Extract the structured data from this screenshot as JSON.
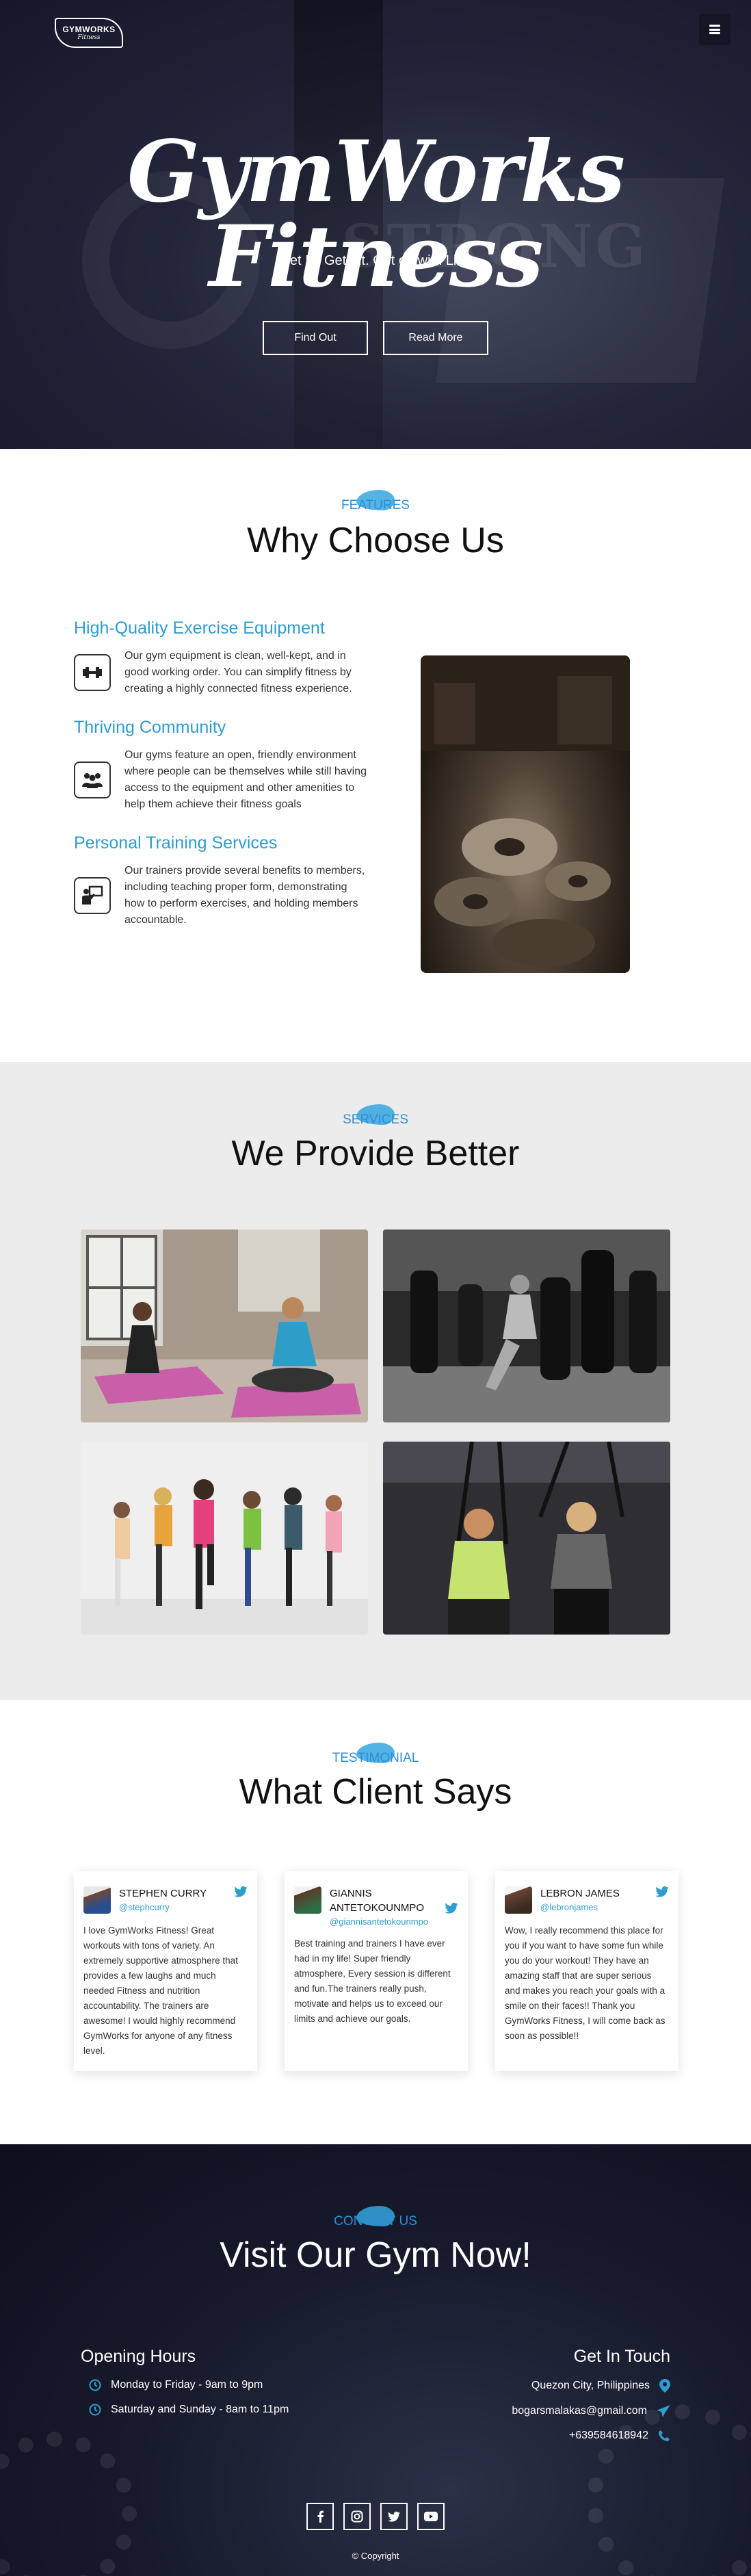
{
  "header": {
    "logo_line1": "GYMWORKS",
    "logo_line2": "Fitness",
    "menu_icon": "hamburger-menu-icon"
  },
  "hero": {
    "title": "GymWorks Fitness",
    "subtitle": "Get In. Get Fit. Get on with Life.",
    "buttons": [
      {
        "label": "Find Out"
      },
      {
        "label": "Read More"
      }
    ]
  },
  "features": {
    "tag": "FEATURES",
    "title": "Why Choose Us",
    "items": [
      {
        "title": "High-Quality Exercise Equipment",
        "icon": "dumbbell-icon",
        "text": "Our gym equipment is clean, well-kept, and in good working order. You can simplify fitness by creating a highly connected fitness experience."
      },
      {
        "title": "Thriving Community",
        "icon": "people-group-icon",
        "text": "Our gyms feature an open, friendly environment where people can be themselves while still having access to the equipment and other amenities to help them achieve their fitness goals"
      },
      {
        "title": "Personal Training Services",
        "icon": "trainer-board-icon",
        "text": "Our trainers provide several benefits to members, including teaching proper form, demonstrating how to perform exercises, and holding members accountable."
      }
    ]
  },
  "services": {
    "tag": "SERVICES",
    "title": "We Provide Better"
  },
  "testimonials": {
    "tag": "TESTIMONIAL",
    "title": "What Client Says",
    "cards": [
      {
        "name": "STEPHEN CURRY",
        "handle": "@stephcurry",
        "text": "I love GymWorks Fitness! Great workouts with tons of variety. An extremely supportive atmosphere that provides a few laughs and much needed Fitness and nutrition accountability. The trainers are awesome! I would highly recommend GymWorks for anyone of any fitness level."
      },
      {
        "name": "GIANNIS ANTETOKOUNMPO",
        "handle": "@giannisantetokounmpo",
        "text": "Best training and trainers I have ever had in my life! Super friendly atmosphere, Every session is different and fun.The trainers really push, motivate and helps us to exceed our limits and achieve our goals."
      },
      {
        "name": "LEBRON JAMES",
        "handle": "@lebronjames",
        "text": "Wow, I really recommend this place for you if you want to have some fun while you do your workout! They have an amazing staff that are super serious and makes you reach your goals with a smile on their faces!! Thank you GymWorks Fitness, I will come back as soon as possible!!"
      }
    ]
  },
  "contact": {
    "tag": "CONTACT US",
    "title": "Visit Our Gym Now!",
    "hours_title": "Opening Hours",
    "hours": [
      "Monday to Friday - 9am to 9pm",
      "Saturday and Sunday - 8am to 11pm"
    ],
    "touch_title": "Get In Touch",
    "location": "Quezon City, Philippines",
    "email": "bogarsmalakas@gmail.com",
    "phone": "+639584618942",
    "social_icons": [
      "facebook-icon",
      "instagram-icon",
      "twitter-icon",
      "youtube-icon"
    ],
    "copyright": "© Copyright"
  },
  "colors": {
    "accent": "#2e9dd0",
    "hero_bg": "#23263a",
    "services_bg": "#ececec",
    "footer_bg": "#161a2c"
  }
}
